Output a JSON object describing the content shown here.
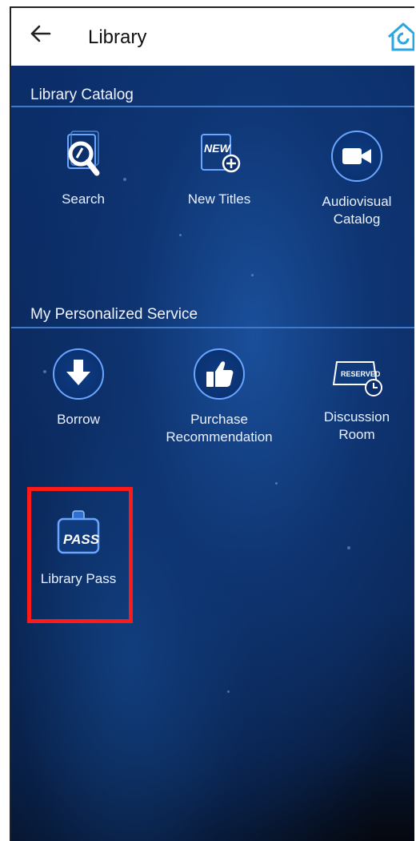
{
  "header": {
    "back_icon": "arrow-left-icon",
    "title": "Library",
    "home_icon": "home-icon"
  },
  "catalog_section": {
    "title": "Library Catalog",
    "items": [
      {
        "label": "Search",
        "icon": "search-icon"
      },
      {
        "label": "New Titles",
        "icon": "new-titles-icon"
      },
      {
        "label": "Audiovisual\nCatalog",
        "icon": "video-camera-icon"
      }
    ]
  },
  "personal_section": {
    "title": "My Personalized Service",
    "items": [
      {
        "label": "Borrow",
        "icon": "download-arrow-icon"
      },
      {
        "label": "Purchase\nRecommendation",
        "icon": "thumbs-up-icon"
      },
      {
        "label": "Discussion\nRoom",
        "icon": "reserved-sign-icon"
      },
      {
        "label": "Library Pass",
        "icon": "pass-badge-icon"
      }
    ]
  },
  "icon_text": {
    "new": "NEW",
    "reserved": "RESERVED",
    "pass": "PASS"
  },
  "colors": {
    "highlight": "#ff1a1a",
    "accent": "#3f79c7",
    "background": "#0b2e6a"
  }
}
